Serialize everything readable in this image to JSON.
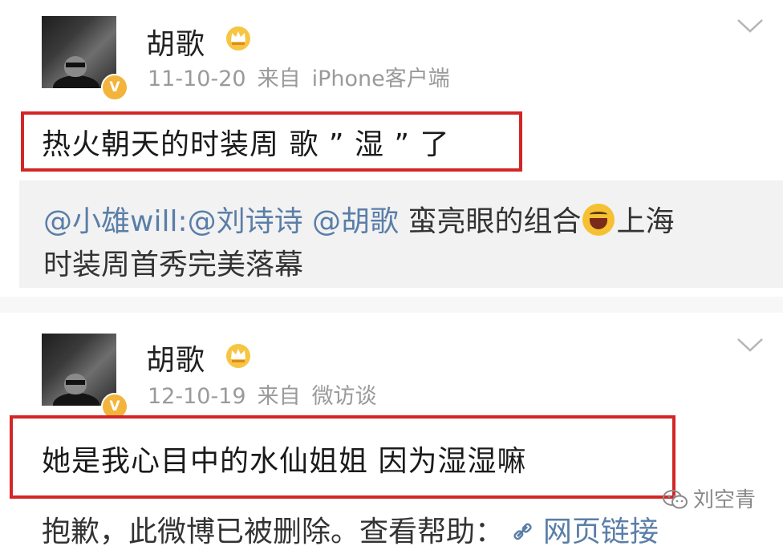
{
  "post1": {
    "username": "胡歌",
    "meta_date": "11-10-20",
    "meta_from": "来自",
    "meta_source": "iPhone客户端",
    "content": "热火朝天的时装周 歌 ” 湿 ” 了",
    "repost_mentions": "@小雄will:@刘诗诗 @胡歌",
    "repost_text_a": " 蛮亮眼的组合",
    "repost_text_b": "上海",
    "repost_line2": "时装周首秀完美落幕"
  },
  "post2": {
    "username": "胡歌",
    "meta_date": "12-10-19",
    "meta_from": "来自",
    "meta_source": "微访谈",
    "content": "她是我心目中的水仙姐姐 因为湿湿嘛"
  },
  "bottom": {
    "text": "抱歉，此微博已被删除。查看帮助：",
    "link": "网页链接"
  },
  "watermark": {
    "text": "刘空青"
  },
  "icons": {
    "verified_badge": "verified-v-badge",
    "vip_crown": "crown-icon",
    "dropdown": "chevron-down-icon",
    "emoji": "laughing-emoji",
    "link": "link-icon",
    "wechat": "wechat-icon"
  },
  "colors": {
    "highlight_border": "#d32626",
    "mention": "#5a7ea8",
    "badge": "#f3b43c"
  }
}
